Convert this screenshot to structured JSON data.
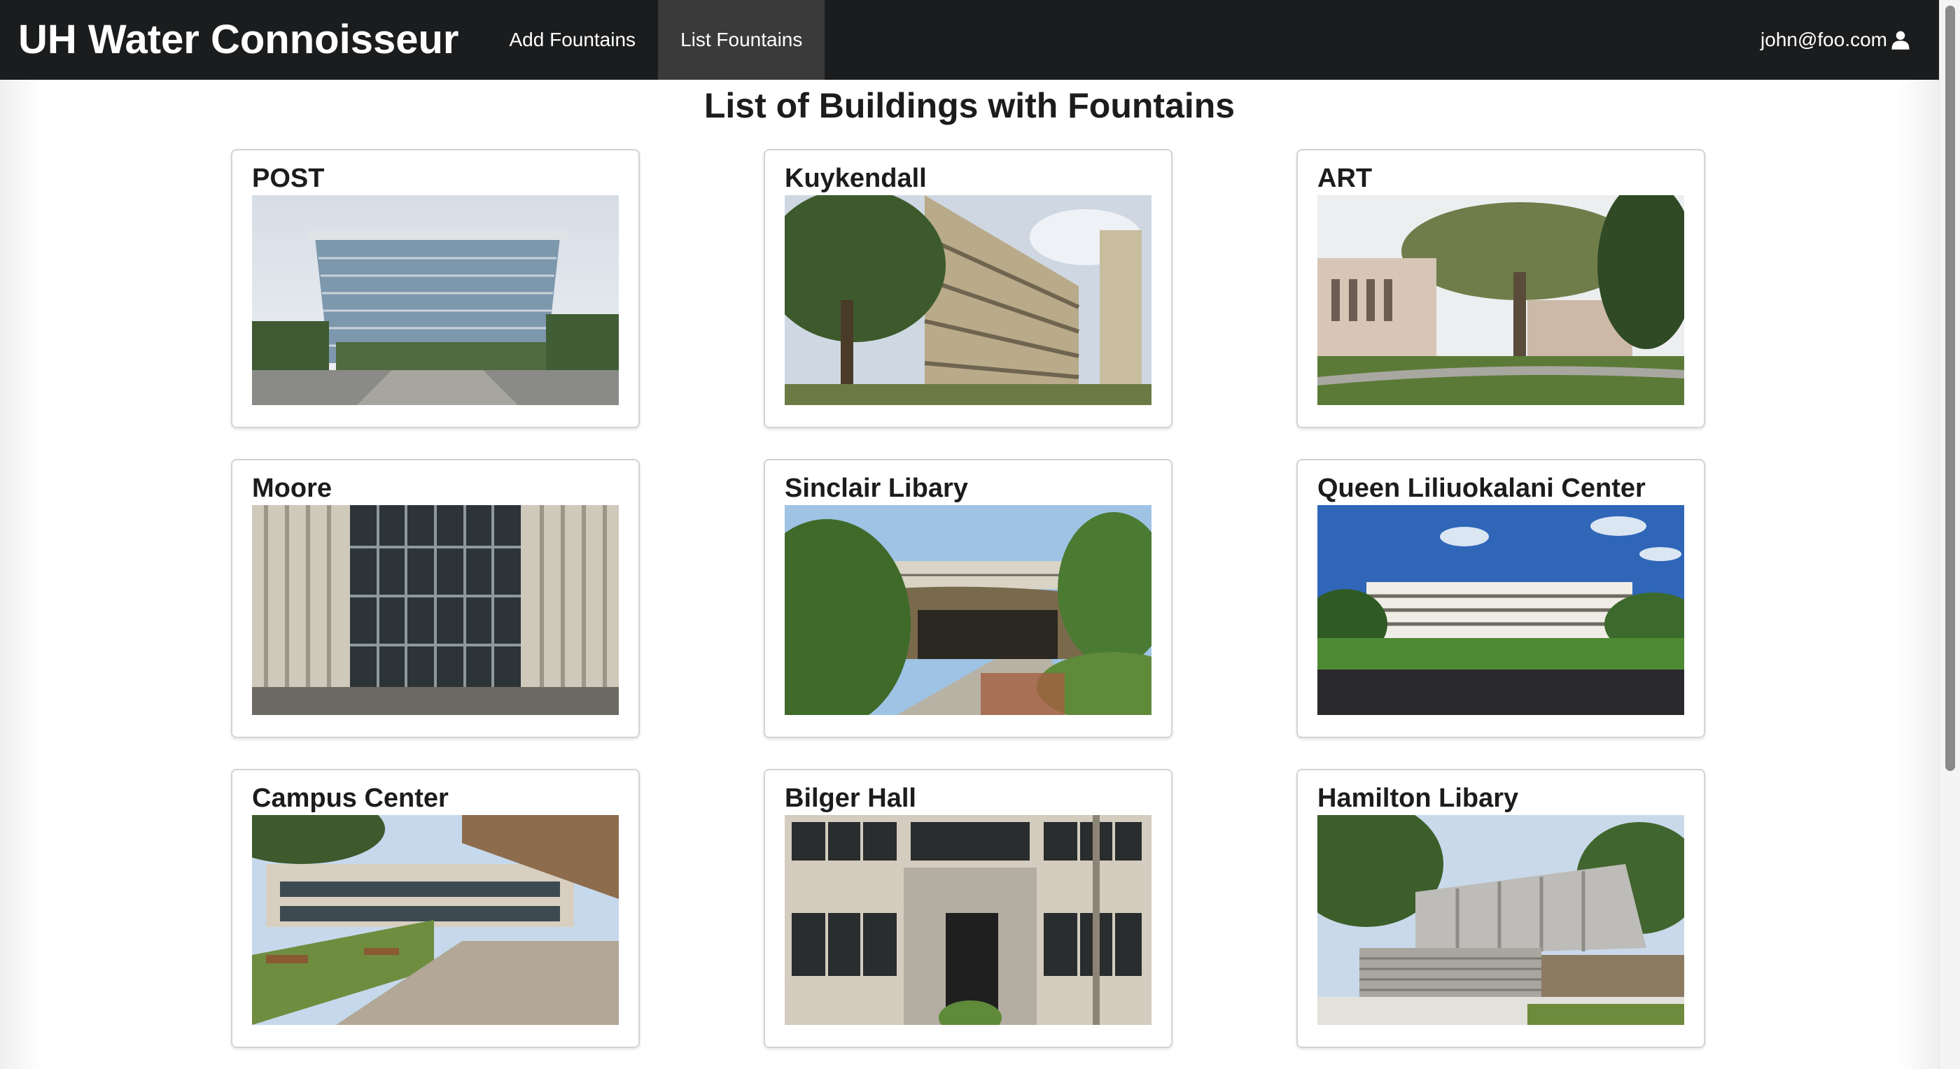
{
  "app": {
    "title": "UH Water Connoisseur"
  },
  "nav": {
    "items": [
      {
        "label": "Add Fountains",
        "active": false
      },
      {
        "label": "List Fountains",
        "active": true
      }
    ],
    "user": "john@foo.com",
    "user_icon": "user-icon"
  },
  "main": {
    "heading": "List of Buildings with Fountains",
    "buildings": [
      {
        "name": "POST",
        "image": "post-building-photo"
      },
      {
        "name": "Kuykendall",
        "image": "kuykendall-building-photo"
      },
      {
        "name": "ART",
        "image": "art-building-photo"
      },
      {
        "name": "Moore",
        "image": "moore-building-photo"
      },
      {
        "name": "Sinclair Libary",
        "image": "sinclair-library-photo"
      },
      {
        "name": "Queen Liliuokalani Center",
        "image": "queen-liliuokalani-center-photo"
      },
      {
        "name": "Campus Center",
        "image": "campus-center-photo"
      },
      {
        "name": "Bilger Hall",
        "image": "bilger-hall-photo"
      },
      {
        "name": "Hamilton Libary",
        "image": "hamilton-library-photo"
      }
    ]
  },
  "colors": {
    "navbar": "#1b1c1d",
    "active_tab": "#3a3a3a",
    "text": "#1b1c1d",
    "card_border": "#d4d4d5"
  }
}
